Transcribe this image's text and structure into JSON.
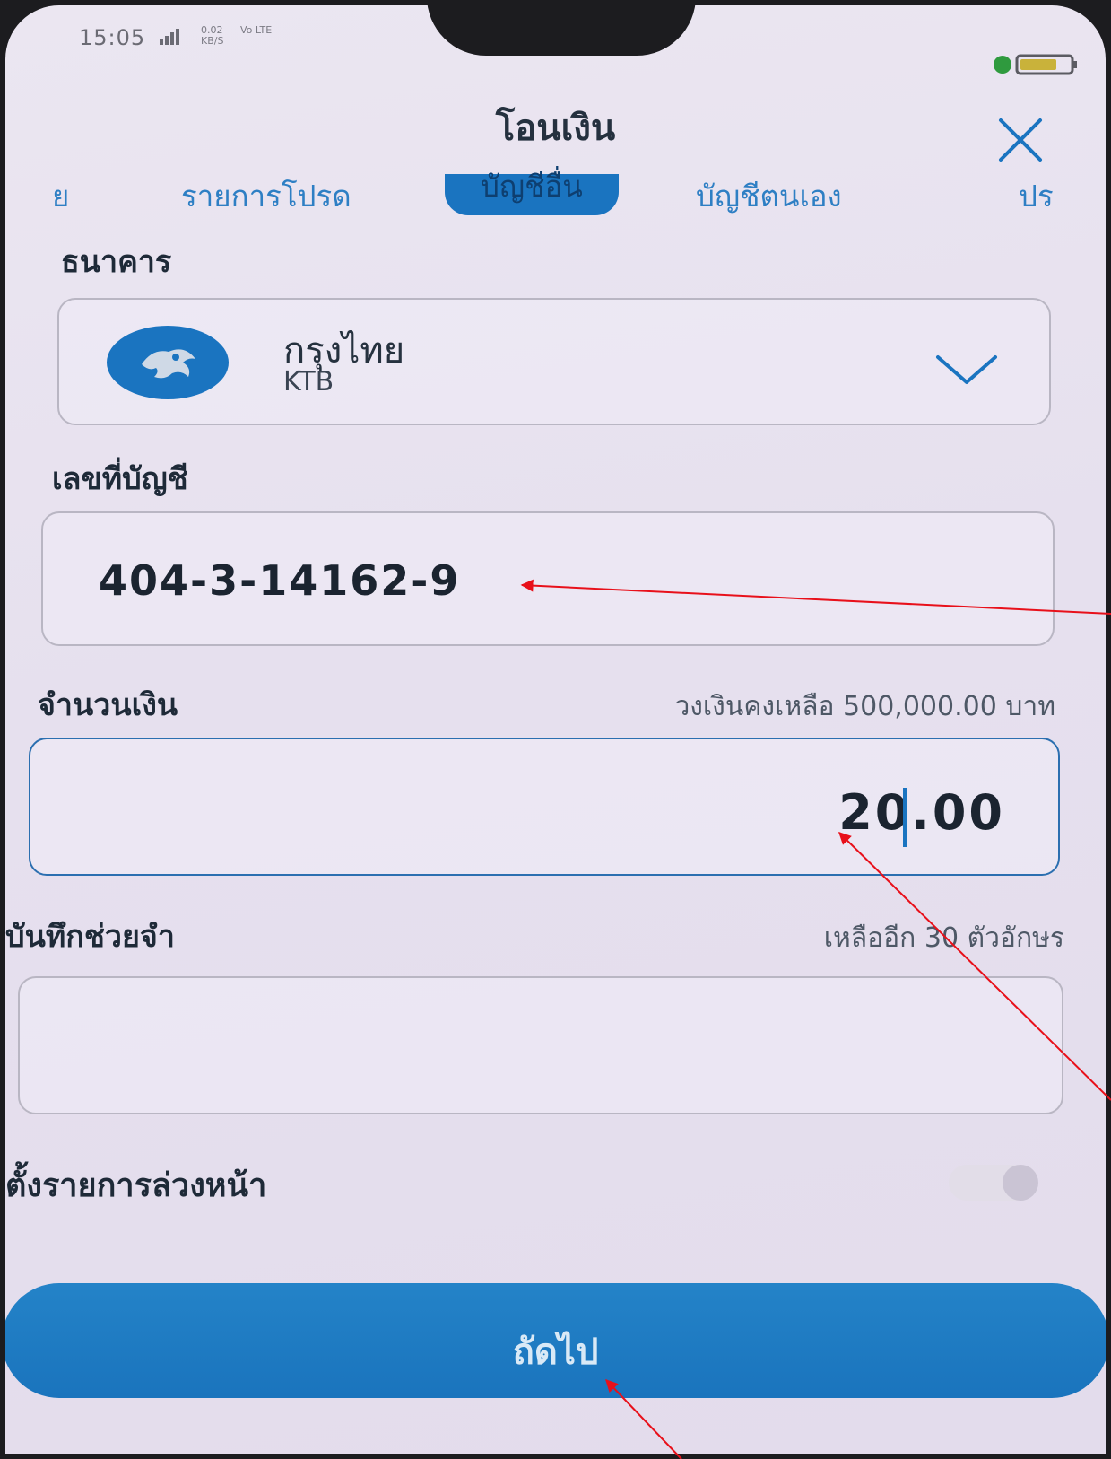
{
  "status_bar": {
    "time": "15:05",
    "network_line1": "0.02",
    "network_line2": "KB/S",
    "network_line3": "Vo LTE"
  },
  "header": {
    "title": "โอนเงิน"
  },
  "tabs": [
    {
      "label": "ย"
    },
    {
      "label": "รายการโปรด"
    },
    {
      "label": "บัญชีอื่น"
    },
    {
      "label": "บัญชีตนเอง"
    },
    {
      "label": "ปร"
    }
  ],
  "bank": {
    "label": "ธนาคาร",
    "name": "กรุงไทย",
    "code": "KTB"
  },
  "account": {
    "label": "เลขที่บัญชี",
    "value": "404-3-14162-9"
  },
  "amount": {
    "label": "จำนวนเงิน",
    "limit_text": "วงเงินคงเหลือ 500,000.00 บาท",
    "value": "20.00"
  },
  "memo": {
    "label": "บันทึกช่วยจำ",
    "remaining_text": "เหลืออีก 30 ตัวอักษร",
    "value": ""
  },
  "schedule": {
    "label": "ตั้งรายการล่วงหน้า",
    "enabled": false
  },
  "footer": {
    "next_label": "ถัดไป"
  },
  "colors": {
    "accent": "#1a74c0",
    "annotation_arrow": "#e8101a"
  }
}
